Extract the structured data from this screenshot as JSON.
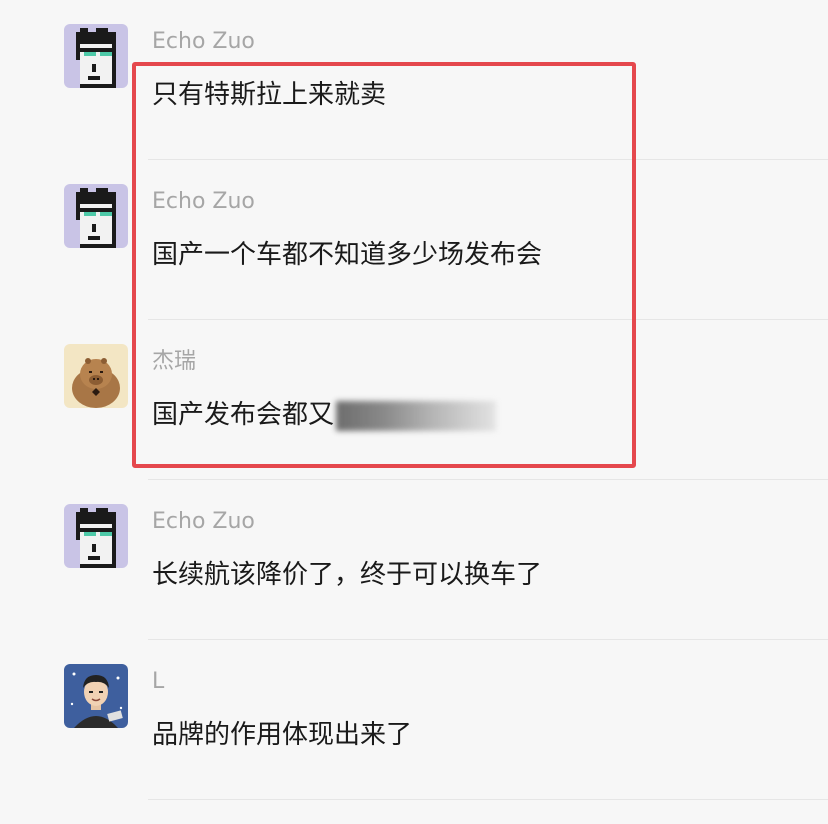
{
  "messages": [
    {
      "sender": "Echo Zuo",
      "text": "只有特斯拉上来就卖",
      "avatar_icon": "pixel-punk-avatar-icon"
    },
    {
      "sender": "Echo Zuo",
      "text": "国产一个车都不知道多少场发布会",
      "avatar_icon": "pixel-punk-avatar-icon"
    },
    {
      "sender": "杰瑞",
      "text": "国产发布会都又",
      "avatar_icon": "capybara-avatar-icon"
    },
    {
      "sender": "Echo Zuo",
      "text": "长续航该降价了，终于可以换车了",
      "avatar_icon": "pixel-punk-avatar-icon"
    },
    {
      "sender": "L",
      "text": "品牌的作用体现出来了",
      "avatar_icon": "cartoon-man-avatar-icon"
    }
  ],
  "colors": {
    "background": "#f7f7f7",
    "sender_name": "#a6a6a6",
    "message_text": "#1a1a1a",
    "highlight_border": "#e5484d"
  }
}
